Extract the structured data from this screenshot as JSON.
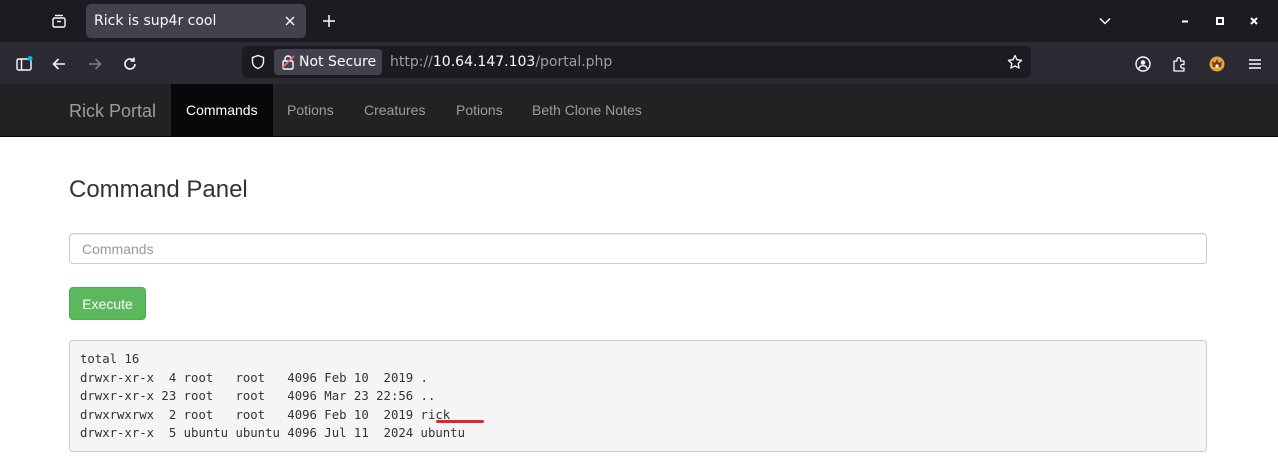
{
  "browser": {
    "tab_title": "Rick is sup4r cool",
    "security_label": "Not Secure",
    "url_prefix": "http://",
    "url_host": "10.64.147.103",
    "url_path": "/portal.php"
  },
  "site": {
    "brand": "Rick Portal",
    "nav": [
      {
        "label": "Commands",
        "active": true
      },
      {
        "label": "Potions"
      },
      {
        "label": "Creatures"
      },
      {
        "label": "Potions"
      },
      {
        "label": "Beth Clone Notes"
      }
    ]
  },
  "panel": {
    "title": "Command Panel",
    "input_placeholder": "Commands",
    "input_value": "",
    "execute_label": "Execute"
  },
  "output": {
    "lines": [
      "total 16",
      "drwxr-xr-x  4 root   root   4096 Feb 10  2019 .",
      "drwxr-xr-x 23 root   root   4096 Mar 23 22:56 ..",
      "drwxrwxrwx  2 root   root   4096 Feb 10  2019 rick",
      "drwxr-xr-x  5 ubuntu ubuntu 4096 Jul 11  2024 ubuntu"
    ]
  },
  "colors": {
    "site_navbar": "#222222",
    "active_nav": "#080808",
    "execute_button": "#5cb85c",
    "annotation_underline": "#e0252b"
  }
}
